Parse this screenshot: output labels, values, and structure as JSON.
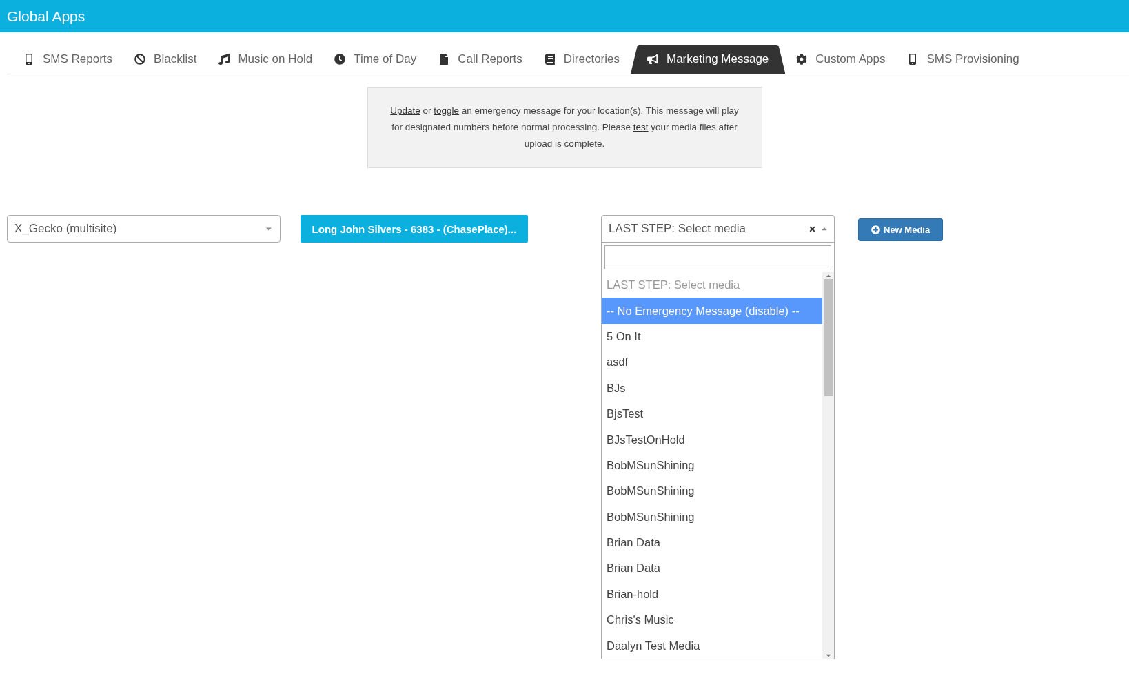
{
  "header": {
    "title": "Global Apps"
  },
  "tabs": [
    {
      "label": "SMS Reports",
      "selected": false
    },
    {
      "label": "Blacklist",
      "selected": false
    },
    {
      "label": "Music on Hold",
      "selected": false
    },
    {
      "label": "Time of Day",
      "selected": false
    },
    {
      "label": "Call Reports",
      "selected": false
    },
    {
      "label": "Directories",
      "selected": false
    },
    {
      "label": "Marketing Message",
      "selected": true
    },
    {
      "label": "Custom Apps",
      "selected": false
    },
    {
      "label": "SMS Provisioning",
      "selected": false
    }
  ],
  "notice": [
    {
      "kind": "link",
      "text": "Update"
    },
    {
      "kind": "text",
      "text": " or "
    },
    {
      "kind": "link",
      "text": "toggle"
    },
    {
      "kind": "text",
      "text": " an emergency message for your location(s). This message will play for designated numbers before normal processing. Please "
    },
    {
      "kind": "link",
      "text": "test"
    },
    {
      "kind": "text",
      "text": " your media files after upload is complete."
    }
  ],
  "location_select": {
    "value": "X_Gecko (multisite)"
  },
  "site_button": {
    "label": "Long John Silvers - 6383 - (ChasePlace)..."
  },
  "media_select": {
    "value": "LAST STEP: Select media",
    "expanded": true,
    "options": [
      {
        "label": "LAST STEP: Select media",
        "disabled": true,
        "highlighted": false
      },
      {
        "label": "-- No Emergency Message (disable) --",
        "disabled": false,
        "highlighted": true
      },
      {
        "label": "5 On It",
        "disabled": false,
        "highlighted": false
      },
      {
        "label": "asdf",
        "disabled": false,
        "highlighted": false
      },
      {
        "label": "BJs",
        "disabled": false,
        "highlighted": false
      },
      {
        "label": "BjsTest",
        "disabled": false,
        "highlighted": false
      },
      {
        "label": "BJsTestOnHold",
        "disabled": false,
        "highlighted": false
      },
      {
        "label": "BobMSunShining",
        "disabled": false,
        "highlighted": false
      },
      {
        "label": "BobMSunShining",
        "disabled": false,
        "highlighted": false
      },
      {
        "label": "BobMSunShining",
        "disabled": false,
        "highlighted": false
      },
      {
        "label": "Brian Data",
        "disabled": false,
        "highlighted": false
      },
      {
        "label": "Brian Data",
        "disabled": false,
        "highlighted": false
      },
      {
        "label": "Brian-hold",
        "disabled": false,
        "highlighted": false
      },
      {
        "label": "Chris's Music",
        "disabled": false,
        "highlighted": false
      },
      {
        "label": "Daalyn Test Media",
        "disabled": false,
        "highlighted": false
      }
    ]
  },
  "new_media_button": {
    "label": "New Media"
  }
}
